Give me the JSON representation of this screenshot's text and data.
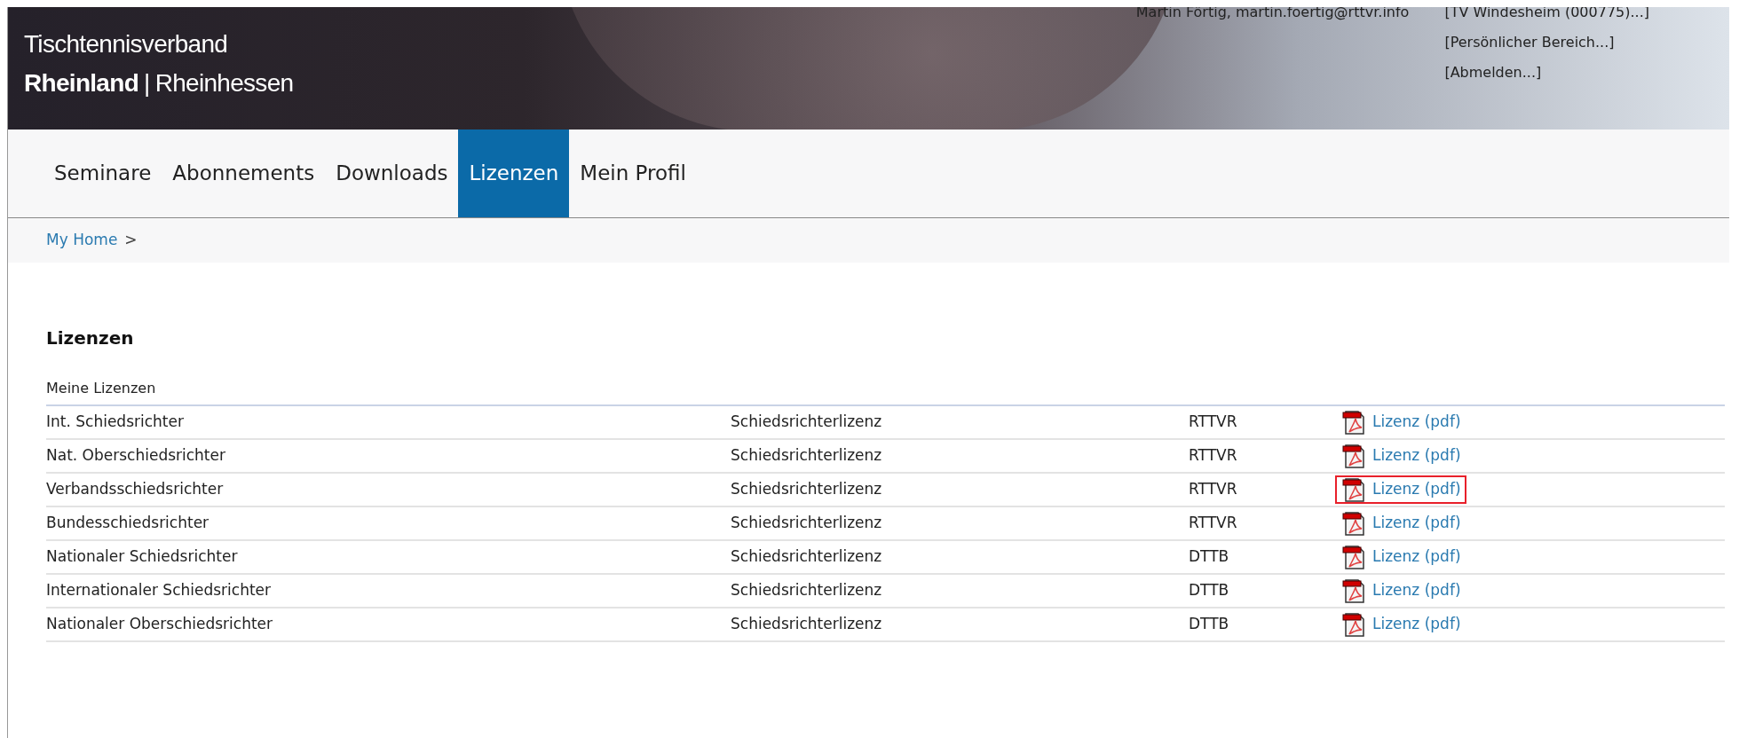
{
  "header": {
    "logo_line_1": "Tischtennisverband",
    "logo_line_2_bold": "Rheinland",
    "logo_separator": "|",
    "logo_line_2": "Rheinhessen",
    "user": "Martin Förtig, martin.foertig@rttvr.info",
    "links": [
      "[TV Windesheim (000775)...]",
      "[Persönlicher Bereich...]",
      "[Abmelden...]"
    ]
  },
  "nav": [
    {
      "label": "Seminare",
      "selected": false
    },
    {
      "label": "Abonnements",
      "selected": false
    },
    {
      "label": "Downloads",
      "selected": false
    },
    {
      "label": "Lizenzen",
      "selected": true
    },
    {
      "label": "Mein Profil",
      "selected": false
    }
  ],
  "breadcrumb": {
    "link": "My Home",
    "separator": ">"
  },
  "title": "Lizenzen",
  "table": {
    "caption": "Meine Lizenzen",
    "rows": [
      {
        "name": "Int. Schiedsrichter",
        "type": "Schiedsrichterlizenz",
        "org": "RTTVR",
        "link": "Lizenz (pdf)",
        "highlighted": false
      },
      {
        "name": "Nat. Oberschiedsrichter",
        "type": "Schiedsrichterlizenz",
        "org": "RTTVR",
        "link": "Lizenz (pdf)",
        "highlighted": false
      },
      {
        "name": "Verbandsschiedsrichter",
        "type": "Schiedsrichterlizenz",
        "org": "RTTVR",
        "link": "Lizenz (pdf)",
        "highlighted": true
      },
      {
        "name": "Bundesschiedsrichter",
        "type": "Schiedsrichterlizenz",
        "org": "RTTVR",
        "link": "Lizenz (pdf)",
        "highlighted": false
      },
      {
        "name": "Nationaler Schiedsrichter",
        "type": "Schiedsrichterlizenz",
        "org": "DTTB",
        "link": "Lizenz (pdf)",
        "highlighted": false
      },
      {
        "name": "Internationaler Schiedsrichter",
        "type": "Schiedsrichterlizenz",
        "org": "DTTB",
        "link": "Lizenz (pdf)",
        "highlighted": false
      },
      {
        "name": "Nationaler Oberschiedsrichter",
        "type": "Schiedsrichterlizenz",
        "org": "DTTB",
        "link": "Lizenz (pdf)",
        "highlighted": false
      }
    ]
  }
}
